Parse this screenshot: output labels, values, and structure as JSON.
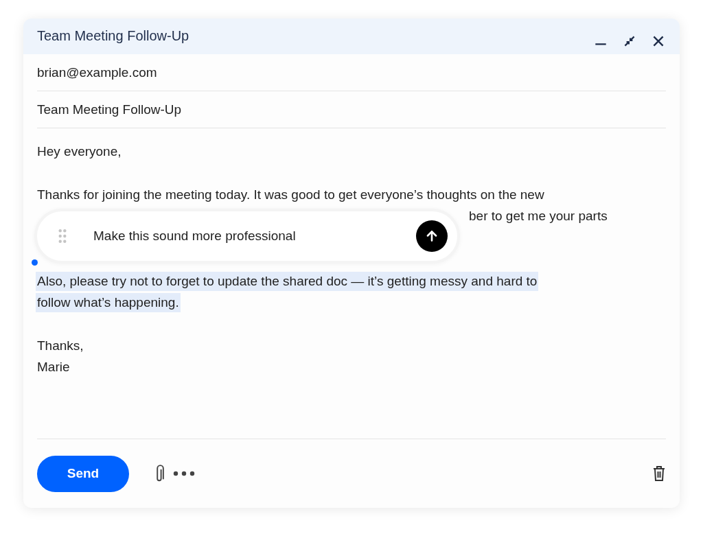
{
  "window": {
    "title": "Team Meeting Follow-Up"
  },
  "to": "brian@example.com",
  "subject": "Team Meeting Follow-Up",
  "paragraphs": [
    {
      "selected": false,
      "lines": [
        {
          "kind": "full",
          "text": "Hey everyone,"
        }
      ]
    },
    {
      "selected": false,
      "lines": [
        {
          "kind": "full",
          "text": "Thanks for joining the meeting today. It was good to get everyone’s thoughts on the new"
        },
        {
          "kind": "covered",
          "text": "ber to get me your parts"
        }
      ]
    },
    {
      "selected": true,
      "lines": [
        {
          "kind": "full",
          "text": "Also, please try not to forget to update the shared doc — it’s getting messy and hard to"
        },
        {
          "kind": "full",
          "text": "follow what’s happening."
        }
      ]
    },
    {
      "selected": false,
      "lines": [
        {
          "kind": "full",
          "text": "Thanks,"
        },
        {
          "kind": "full",
          "text": "Marie"
        }
      ]
    }
  ],
  "prompt": {
    "text": "Make this sound more professional"
  },
  "send_button": "Send"
}
